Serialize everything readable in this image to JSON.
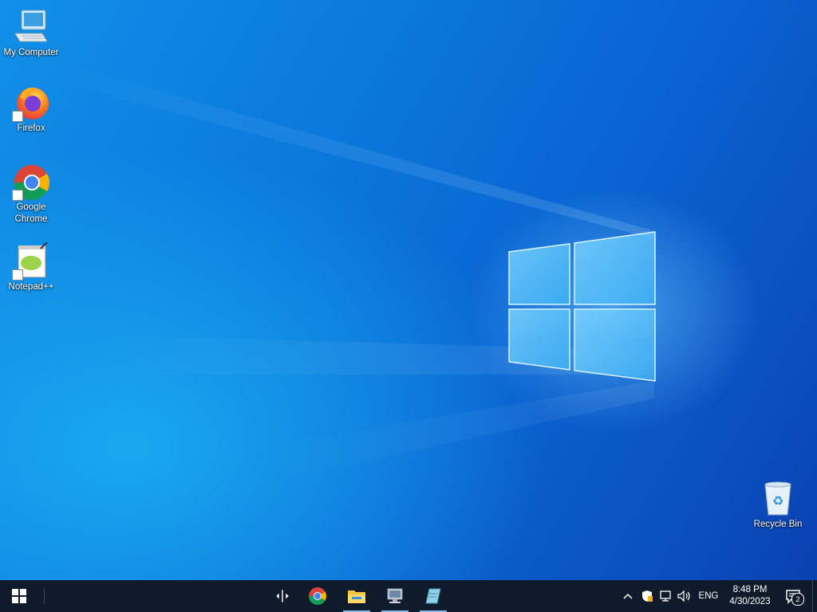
{
  "desktop": {
    "icons": [
      {
        "label": "My Computer",
        "icon": "computer-icon"
      },
      {
        "label": "Firefox",
        "icon": "firefox-icon"
      },
      {
        "label": "Google Chrome",
        "icon": "chrome-icon"
      },
      {
        "label": "Notepad++",
        "icon": "notepadpp-icon"
      },
      {
        "label": "Recycle Bin",
        "icon": "recycle-bin-icon"
      }
    ],
    "accent": "#0a78dc"
  },
  "taskbar": {
    "start": {
      "icon": "windows-start-icon"
    },
    "apps": [
      {
        "name": "Move cursor",
        "icon": "move-cursor-icon",
        "active": false
      },
      {
        "name": "Google Chrome",
        "icon": "chrome-icon",
        "active": false
      },
      {
        "name": "File Explorer",
        "icon": "folder-icon",
        "active": true
      },
      {
        "name": "Screen app",
        "icon": "monitor-app-icon",
        "active": true
      },
      {
        "name": "Notes app",
        "icon": "notes-app-icon",
        "active": true
      }
    ],
    "tray": {
      "language": "ENG",
      "time": "8:48 PM",
      "date": "4/30/2023",
      "notifications_count": "2"
    }
  }
}
